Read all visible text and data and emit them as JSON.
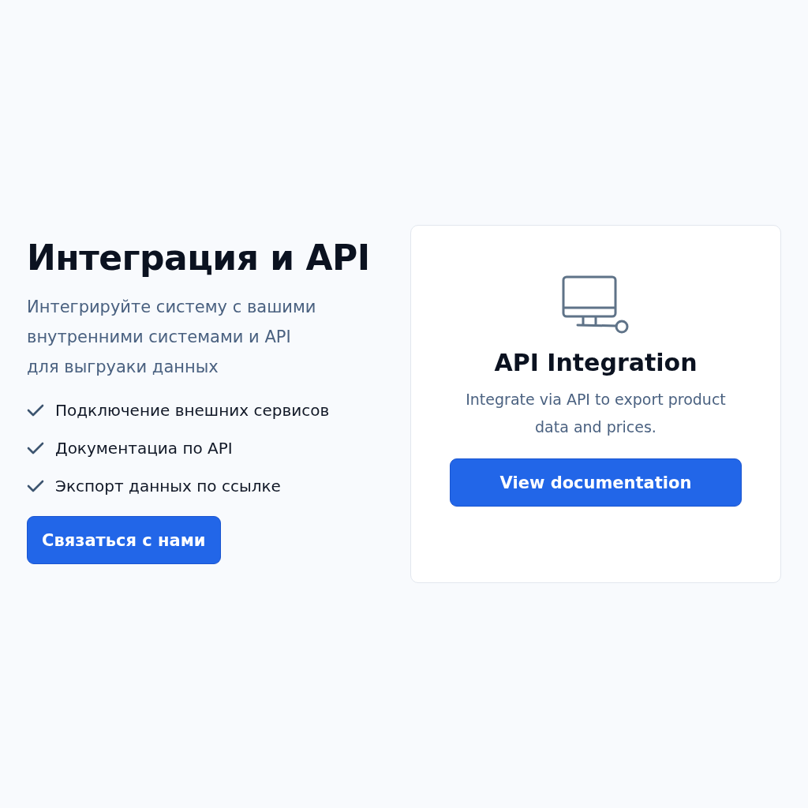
{
  "hero": {
    "title": "Интеграция и API",
    "description_lines": [
      "Интегрируйте систему с вашими",
      "внутренними системами и API",
      "для выгруаки данных"
    ],
    "features": [
      {
        "label": "Подключение внешних сервисов",
        "checked": true
      },
      {
        "label": "Документациа по API",
        "checked": true
      },
      {
        "label": "Экспорт данных по ссылке",
        "checked": true
      }
    ],
    "cta": "Связаться с нами"
  },
  "card": {
    "title": "API Integration",
    "description_lines": [
      "Integrate via API to export product",
      "data and prices."
    ],
    "button": "View documentation"
  }
}
